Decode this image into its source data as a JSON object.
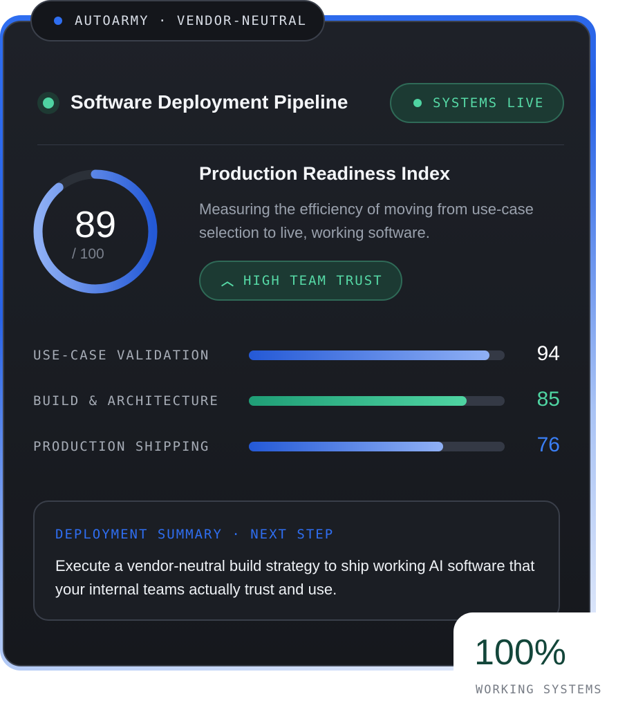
{
  "top_pill": {
    "text": "AUTOARMY · VENDOR-NEUTRAL",
    "dot_color": "#2f6ef0"
  },
  "header": {
    "title": "Software Deployment Pipeline",
    "status": "SYSTEMS LIVE",
    "status_color": "#4fd4a2"
  },
  "index": {
    "score": "89",
    "max": "/ 100",
    "score_fraction": 0.89,
    "title": "Production Readiness Index",
    "description": "Measuring the efficiency of moving from use-case selection to live, working software.",
    "trust_label": "HIGH TEAM TRUST",
    "trust_icon": "chevron-up-icon"
  },
  "metrics": [
    {
      "label": "USE-CASE VALIDATION",
      "value": "94",
      "fill": 0.94,
      "color": "#ffffff",
      "bar": "blue"
    },
    {
      "label": "BUILD & ARCHITECTURE",
      "value": "85",
      "fill": 0.85,
      "color": "#4fd4a2",
      "bar": "green"
    },
    {
      "label": "PRODUCTION SHIPPING",
      "value": "76",
      "fill": 0.76,
      "color": "#3a7ef5",
      "bar": "blue"
    }
  ],
  "summary": {
    "heading": "DEPLOYMENT SUMMARY · NEXT STEP",
    "body": "Execute a vendor-neutral build strategy to ship working AI software that your internal teams actually trust and use."
  },
  "badge": {
    "value": "100%",
    "label": "WORKING SYSTEMS"
  }
}
